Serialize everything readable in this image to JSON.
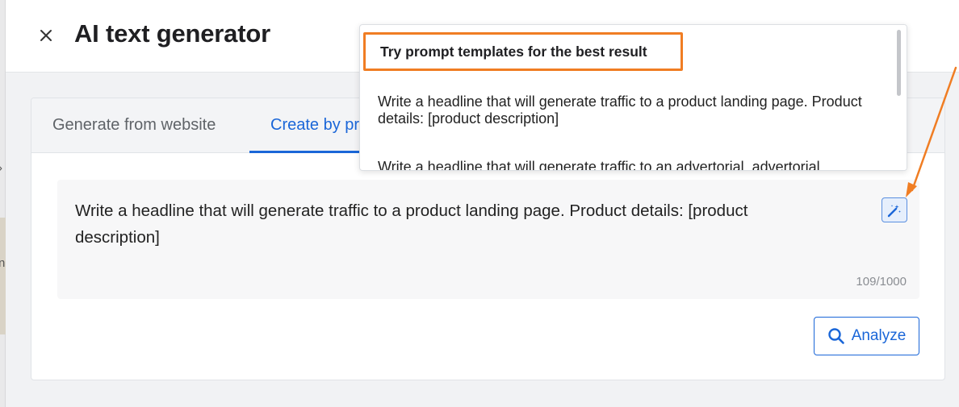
{
  "header": {
    "title": "AI text generator",
    "close_icon": "close-icon"
  },
  "tabs": [
    {
      "label": "Generate from website",
      "active": false
    },
    {
      "label": "Create by prompt",
      "active": true
    }
  ],
  "prompt": {
    "text": "Write a headline that will generate traffic to a product landing page. Product details: [product description]",
    "counter": "109/1000",
    "magic_icon": "magic-wand-icon"
  },
  "analyze": {
    "label": "Analyze",
    "icon": "search-icon"
  },
  "dropdown": {
    "header": "Try prompt templates for the best result",
    "items": [
      "Write a headline that will generate traffic to a product landing page. Product details: [product description]",
      "Write a headline that will generate traffic to an advertorial. advertorial"
    ]
  },
  "colors": {
    "accent": "#1a66d8",
    "highlight": "#f07d23"
  }
}
